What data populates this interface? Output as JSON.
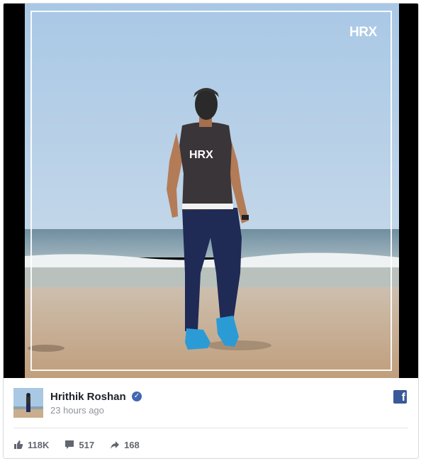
{
  "post": {
    "author": "Hrithik Roshan",
    "timestamp": "23 hours ago",
    "verified_icon": "verified-badge-icon",
    "network_icon": "facebook-icon"
  },
  "media": {
    "corner_logo": "HRX",
    "shirt_logo": "HRX"
  },
  "stats": {
    "likes": "118K",
    "comments": "517",
    "shares": "168"
  },
  "colors": {
    "facebook_blue": "#3b5998",
    "verified_blue": "#4267b2",
    "name_text": "#1d2129",
    "meta_text": "#90949c"
  }
}
